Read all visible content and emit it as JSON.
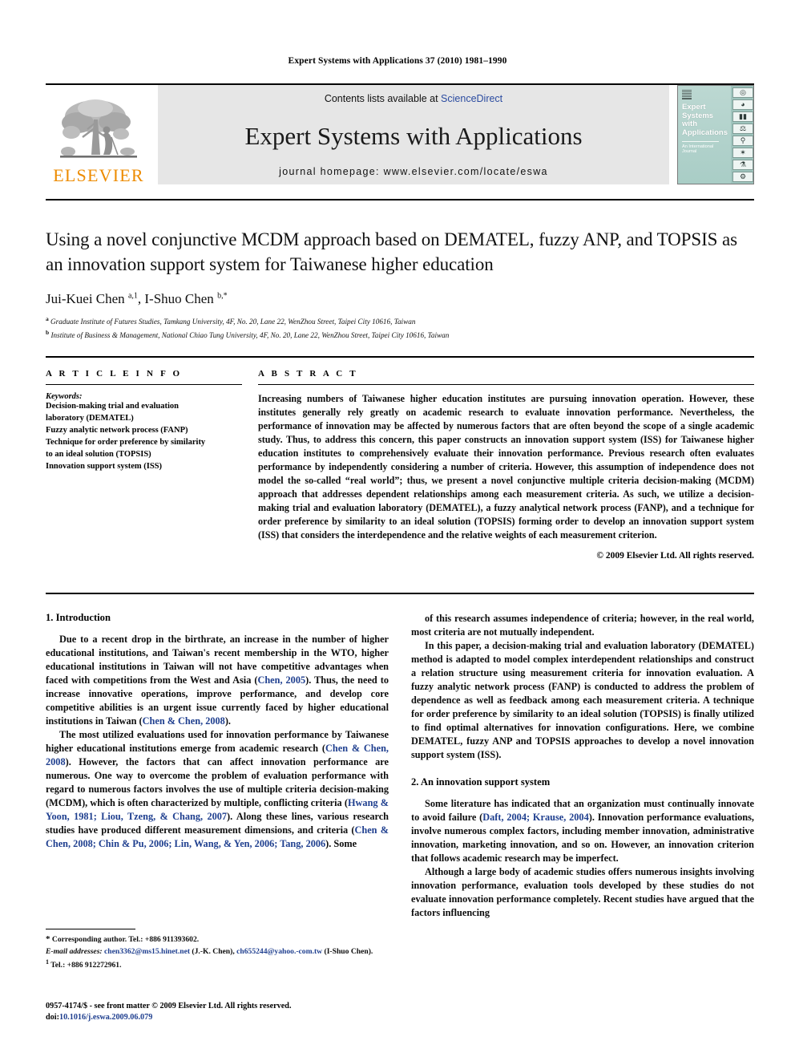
{
  "running_head": "Expert Systems with Applications 37 (2010) 1981–1990",
  "masthead": {
    "publisher_name": "ELSEVIER",
    "contents_prefix": "Contents lists available at ",
    "contents_link": "ScienceDirect",
    "journal_title": "Expert Systems with Applications",
    "homepage": "journal homepage: www.elsevier.com/locate/eswa",
    "cover": {
      "title": "Expert Systems with Applications",
      "subtitle": "An International Journal",
      "icons": [
        "globe-icon",
        "magnifier-icon",
        "bar-chart-icon",
        "scale-icon",
        "microscope-icon",
        "satellite-icon",
        "flask-icon",
        "tool-icon"
      ]
    }
  },
  "article": {
    "title": "Using a novel conjunctive MCDM approach based on DEMATEL, fuzzy ANP, and TOPSIS as an innovation support system for Taiwanese higher education",
    "authors_html": "Jui-Kuei Chen <sup>a,1</sup>, I-Shuo Chen <sup>b,*</sup>",
    "affiliation_a": "Graduate Institute of Futures Studies, Tamkang University, 4F, No. 20, Lane 22, WenZhou Street, Taipei City 10616, Taiwan",
    "affiliation_b": "Institute of Business & Management, National Chiao Tung University, 4F, No. 20, Lane 22, WenZhou Street, Taipei City 10616, Taiwan"
  },
  "article_info": {
    "heading": "A R T I C L E   I N F O",
    "keywords_label": "Keywords:",
    "keywords": [
      "Decision-making trial and evaluation",
      "laboratory (DEMATEL)",
      "Fuzzy analytic network process (FANP)",
      "Technique for order preference by similarity",
      "to an ideal solution (TOPSIS)",
      "Innovation support system (ISS)"
    ]
  },
  "abstract": {
    "heading": "A B S T R A C T",
    "text": "Increasing numbers of Taiwanese higher education institutes are pursuing innovation operation. However, these institutes generally rely greatly on academic research to evaluate innovation performance. Nevertheless, the performance of innovation may be affected by numerous factors that are often beyond the scope of a single academic study. Thus, to address this concern, this paper constructs an innovation support system (ISS) for Taiwanese higher education institutes to comprehensively evaluate their innovation performance. Previous research often evaluates performance by independently considering a number of criteria. However, this assumption of independence does not model the so-called “real world”; thus, we present a novel conjunctive multiple criteria decision-making (MCDM) approach that addresses dependent relationships among each measurement criteria. As such, we utilize a decision-making trial and evaluation laboratory (DEMATEL), a fuzzy analytical network process (FANP), and a technique for order preference by similarity to an ideal solution (TOPSIS) forming order to develop an innovation support system (ISS) that considers the interdependence and the relative weights of each measurement criterion.",
    "copyright": "© 2009 Elsevier Ltd. All rights reserved."
  },
  "sections": {
    "intro_heading": "1. Introduction",
    "intro_p1_html": "Due to a recent drop in the birthrate, an increase in the number of higher educational institutions, and Taiwan's recent membership in the WTO, higher educational institutions in Taiwan will not have competitive advantages when faced with competitions from the West and Asia (<span class=\"cite\">Chen, 2005</span>). Thus, the need to increase innovative operations, improve performance, and develop core competitive abilities is an urgent issue currently faced by higher educational institutions in Taiwan (<span class=\"cite\">Chen &amp; Chen, 2008</span>).",
    "intro_p2_html": "The most utilized evaluations used for innovation performance by Taiwanese higher educational institutions emerge from academic research (<span class=\"cite\">Chen &amp; Chen, 2008</span>). However, the factors that can affect innovation performance are numerous. One way to overcome the problem of evaluation performance with regard to numerous factors involves the use of multiple criteria decision-making (MCDM), which is often characterized by multiple, conflicting criteria (<span class=\"cite\">Hwang &amp; Yoon, 1981; Liou, Tzeng, &amp; Chang, 2007</span>). Along these lines, various research studies have produced different measurement dimensions, and criteria (<span class=\"cite\">Chen &amp; Chen, 2008; Chin &amp; Pu, 2006; Lin, Wang, &amp; Yen, 2006; Tang, 2006</span>). Some",
    "right_p1_html": "of this research assumes independence of criteria; however, in the real world, most criteria are not mutually independent.",
    "right_p2_html": "In this paper, a decision-making trial and evaluation laboratory (DEMATEL) method is adapted to model complex interdependent relationships and construct a relation structure using measurement criteria for innovation evaluation. A fuzzy analytic network process (FANP) is conducted to address the problem of dependence as well as feedback among each measurement criteria. A technique for order preference by similarity to an ideal solution (TOPSIS) is finally utilized to find optimal alternatives for innovation configurations. Here, we combine DEMATEL, fuzzy ANP and TOPSIS approaches to develop a novel innovation support system (ISS).",
    "iss_heading": "2. An innovation support system",
    "iss_p1_html": "Some literature has indicated that an organization must continually innovate to avoid failure (<span class=\"cite\">Daft, 2004; Krause, 2004</span>). Innovation performance evaluations, involve numerous complex factors, including member innovation, administrative innovation, marketing innovation, and so on. However, an innovation criterion that follows academic research may be imperfect.",
    "iss_p2_html": "Although a large body of academic studies offers numerous insights involving innovation performance, evaluation tools developed by these studies do not evaluate innovation performance completely. Recent studies have argued that the factors influencing"
  },
  "footnotes": {
    "corresponding_html": "<span style=\"font-size:11px\">*</span> Corresponding author. Tel.: +886 911393602.",
    "emails_html": "<span class=\"ital\">E-mail addresses:</span> <span class=\"cite\">chen3362@ms15.hinet.net</span> (J.-K. Chen), <span class=\"cite\">ch655244@yahoo.-com.tw</span> (I-Shuo Chen).",
    "note1_html": "<sup>1</sup> Tel.: +886 912272961."
  },
  "imprint": {
    "issn_line": "0957-4174/$ - see front matter © 2009 Elsevier Ltd. All rights reserved.",
    "doi_prefix": "doi:",
    "doi_value": "10.1016/j.eswa.2009.06.079"
  }
}
